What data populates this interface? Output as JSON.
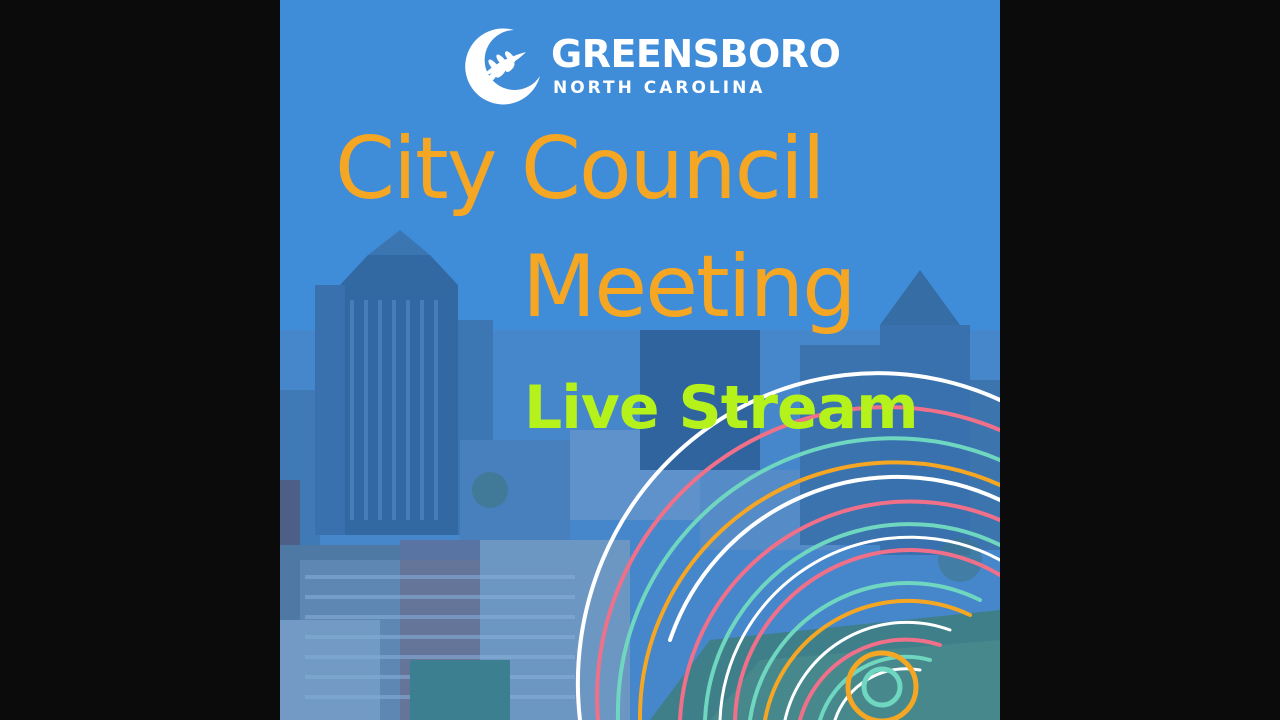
{
  "logo": {
    "name": "GREENSBORO",
    "subtitle": "NORTH CAROLINA",
    "icon": "leaf-crescent-icon"
  },
  "title": {
    "line1": "City Council",
    "line2": "Meeting"
  },
  "live": {
    "label": "Live Stream"
  },
  "colors": {
    "title": "#f5a623",
    "live": "#b5f21b",
    "background_blue": "#4690d3",
    "letterbox": "#0b0b0b",
    "ring_white": "#ffffff",
    "ring_orange": "#f5a623",
    "ring_pink": "#f0708a",
    "ring_teal": "#6fd6c0"
  }
}
